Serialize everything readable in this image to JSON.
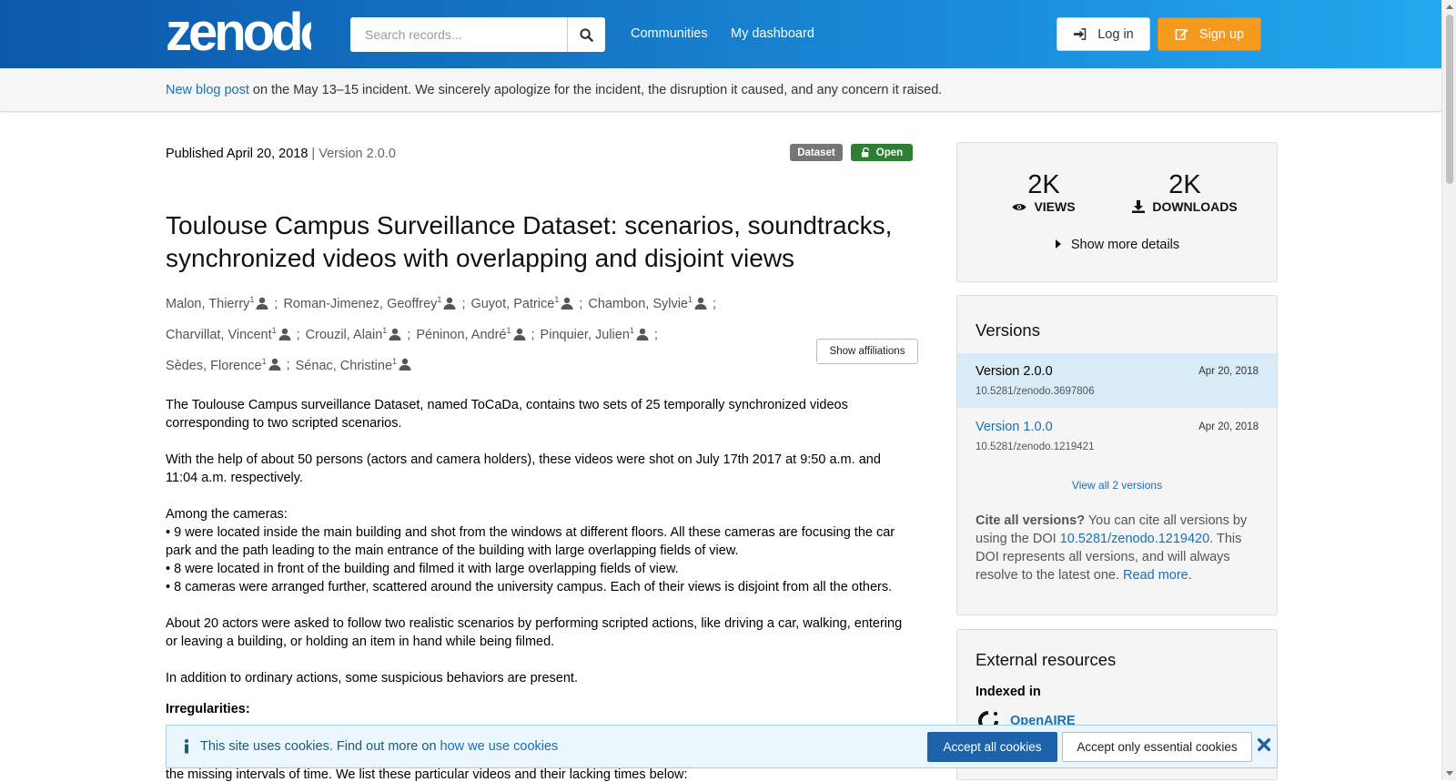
{
  "header": {
    "logo_text": "zenodo",
    "search_placeholder": "Search records...",
    "nav": [
      "Communities",
      "My dashboard"
    ],
    "login_label": "Log in",
    "signup_label": "Sign up"
  },
  "banner": {
    "link_text": "New blog post",
    "text": " on the May 13–15 incident. We sincerely apologize for the incident, the disruption it caused, and any concern it raised."
  },
  "record": {
    "published": "Published April 20, 2018",
    "version_sep": " | ",
    "version": "Version 2.0.0",
    "badge_type": "Dataset",
    "badge_access": "Open",
    "title": "Toulouse Campus Surveillance Dataset: scenarios, soundtracks, synchronized videos with overlapping and disjoint views",
    "creators": [
      {
        "name": "Malon, Thierry",
        "aff": "1"
      },
      {
        "name": "Roman-Jimenez, Geoffrey",
        "aff": "1"
      },
      {
        "name": "Guyot, Patrice",
        "aff": "1"
      },
      {
        "name": "Chambon, Sylvie",
        "aff": "1"
      },
      {
        "name": "Charvillat, Vincent",
        "aff": "1"
      },
      {
        "name": "Crouzil, Alain",
        "aff": "1"
      },
      {
        "name": "Péninon, André",
        "aff": "1"
      },
      {
        "name": "Pinquier, Julien",
        "aff": "1"
      },
      {
        "name": "Sèdes, Florence",
        "aff": "1"
      },
      {
        "name": "Sénac, Christine",
        "aff": "1"
      }
    ],
    "show_affiliations": "Show affiliations",
    "description": {
      "p1": "The Toulouse Campus surveillance Dataset, named ToCaDa, contains two sets of 25 temporally synchronized videos corresponding to two scripted scenarios.",
      "p2": "With the help of about 50 persons (actors and camera holders), these videos were shot on July 17th 2017 at 9:50 a.m. and 11:04 a.m. respectively.",
      "p3_intro": "Among the cameras:",
      "bullets": [
        "• 9 were located inside the main building and shot from the windows at different floors. All these cameras are focusing the car park and the path leading to the main entrance of the building with large overlapping fields of view.",
        "• 8 were located in front of the building and filmed it with large overlapping fields of view.",
        "• 8 cameras were arranged further, scattered around the university campus. Each of their views is disjoint from all the others."
      ],
      "p4": "About 20 actors were asked to follow two realistic scenarios by performing scripted actions, like driving a car, walking, entering or leaving a building, or holding an item in hand while being filmed.",
      "p5": "In addition to ordinary actions, some suspicious behaviors are present.",
      "irregularities": "Irregularities:",
      "tail": "the missing intervals of time. We list these particular videos and their lacking times below:"
    }
  },
  "stats": {
    "views_num": "2K",
    "views_label": "VIEWS",
    "downloads_num": "2K",
    "downloads_label": "DOWNLOADS",
    "more_details": "Show more details"
  },
  "versions": {
    "heading": "Versions",
    "items": [
      {
        "name": "Version 2.0.0",
        "date": "Apr 20, 2018",
        "doi": "10.5281/zenodo.3697806"
      },
      {
        "name": "Version 1.0.0",
        "date": "Apr 20, 2018",
        "doi": "10.5281/zenodo.1219421"
      }
    ],
    "view_all": "View all 2 versions",
    "cite_bold": "Cite all versions?",
    "cite_text1": " You can cite all versions by using the DOI ",
    "cite_doi": "10.5281/zenodo.1219420",
    "cite_text2": ". This DOI represents all versions, and will always resolve to the latest one. ",
    "read_more": "Read more",
    "period": "."
  },
  "external": {
    "heading": "External resources",
    "indexed_in": "Indexed in",
    "openaire": "OpenAIRE"
  },
  "cookie": {
    "text": "This site uses cookies. Find out more on ",
    "link": "how we use cookies",
    "accept_all": "Accept all cookies",
    "accept_essential": "Accept only essential cookies"
  },
  "colors": {
    "header_start": "#0c57a9",
    "header_end": "#22a8ee",
    "signup": "#f39a1f",
    "link": "#1a6fb5",
    "open_badge": "#2e7d32"
  }
}
